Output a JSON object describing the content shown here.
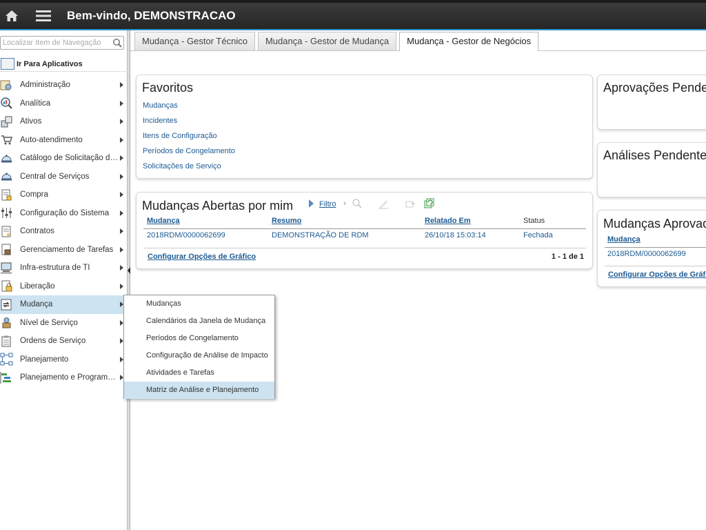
{
  "header": {
    "welcome": "Bem-vindo, DEMONSTRACAO"
  },
  "sidebar": {
    "search_placeholder": "Localizar Item de Navegação",
    "goto_apps": "Ir Para Aplicativos",
    "items": [
      {
        "label": "Administração",
        "icon": "admin-icon"
      },
      {
        "label": "Analítica",
        "icon": "analytics-icon"
      },
      {
        "label": "Ativos",
        "icon": "assets-icon"
      },
      {
        "label": "Auto-atendimento",
        "icon": "cart-icon"
      },
      {
        "label": "Catálogo de Solicitação de Serviço",
        "icon": "service-bell-icon"
      },
      {
        "label": "Central de Serviços",
        "icon": "service-bell-icon"
      },
      {
        "label": "Compra",
        "icon": "purchase-icon"
      },
      {
        "label": "Configuração do Sistema",
        "icon": "sliders-icon"
      },
      {
        "label": "Contratos",
        "icon": "contract-icon"
      },
      {
        "label": "Gerenciamento de Tarefas",
        "icon": "task-icon"
      },
      {
        "label": "Infra-estrutura de TI",
        "icon": "computer-icon"
      },
      {
        "label": "Liberação",
        "icon": "lock-icon"
      },
      {
        "label": "Mudança",
        "icon": "change-icon"
      },
      {
        "label": "Nível de Serviço",
        "icon": "scale-icon"
      },
      {
        "label": "Ordens de Serviço",
        "icon": "clipboard-icon"
      },
      {
        "label": "Planejamento",
        "icon": "flowchart-icon"
      },
      {
        "label": "Planejamento e Programação",
        "icon": "gantt-icon"
      }
    ]
  },
  "flyout": {
    "items": [
      "Mudanças",
      "Calendários da Janela de Mudança",
      "Períodos de Congelamento",
      "Configuração de Análise de Impacto",
      "Atividades e Tarefas",
      "Matriz de Análise e Planejamento"
    ]
  },
  "tabs": [
    "Mudança - Gestor Técnico",
    "Mudança - Gestor de Mudança",
    "Mudança - Gestor de Negócios"
  ],
  "favoritos": {
    "title": "Favoritos",
    "links": [
      "Mudanças",
      "Incidentes",
      "Itens de Configuração",
      "Períodos de Congelamento",
      "Solicitações de Serviço"
    ]
  },
  "mudancas_abertas": {
    "title": "Mudanças Abertas por mim",
    "filter": "Filtro",
    "columns": [
      "Mudança",
      "Resumo",
      "Relatado Em",
      "Status"
    ],
    "rows": [
      [
        "2018RDM/0000062699",
        "DEMONSTRAÇÃO DE RDM",
        "26/10/18 15:03:14",
        "Fechada"
      ]
    ],
    "config_link": "Configurar Opções de Gráfico",
    "count": "1 - 1 de 1"
  },
  "aprovacoes": {
    "title": "Aprovações Pendentes"
  },
  "analises": {
    "title": "Análises Pendentes"
  },
  "mudancas_aprovadas": {
    "title": "Mudanças Aprovadas",
    "column": "Mudança",
    "row": "2018RDM/0000062699",
    "config_link": "Configurar Opções de Gráfico"
  }
}
